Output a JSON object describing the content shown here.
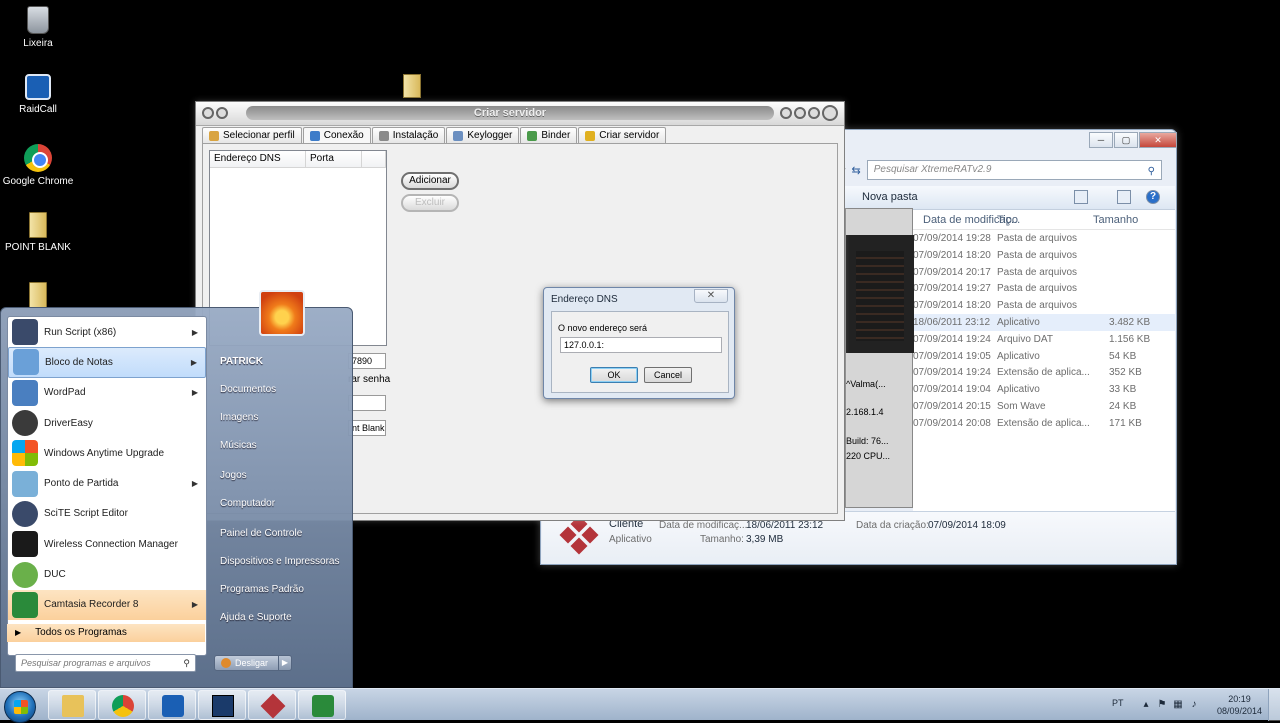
{
  "desktop": {
    "icons": [
      {
        "label": "Lixeira",
        "icon": "recycle-bin-icon"
      },
      {
        "label": "RaidCall",
        "icon": "raidcall-icon"
      },
      {
        "label": "Google Chrome",
        "icon": "chrome-icon"
      },
      {
        "label": "POINT BLANK",
        "icon": "file-icon"
      }
    ]
  },
  "explorer": {
    "search_placeholder": "Pesquisar XtremeRATv2.9",
    "new_folder": "Nova pasta",
    "window_controls": [
      "─",
      "▢",
      "✕"
    ],
    "help": "?",
    "columns": [
      "Data de modificaç...",
      "Tipo",
      "Tamanho"
    ],
    "rows": [
      {
        "date": "07/09/2014 19:28",
        "type": "Pasta de arquivos",
        "size": ""
      },
      {
        "date": "07/09/2014 18:20",
        "type": "Pasta de arquivos",
        "size": ""
      },
      {
        "date": "07/09/2014 20:17",
        "type": "Pasta de arquivos",
        "size": ""
      },
      {
        "date": "07/09/2014 19:27",
        "type": "Pasta de arquivos",
        "size": ""
      },
      {
        "date": "07/09/2014 18:20",
        "type": "Pasta de arquivos",
        "size": ""
      },
      {
        "date": "18/06/2011 23:12",
        "type": "Aplicativo",
        "size": "3.482 KB"
      },
      {
        "date": "07/09/2014 19:24",
        "type": "Arquivo DAT",
        "size": "1.156 KB"
      },
      {
        "date": "07/09/2014 19:05",
        "type": "Aplicativo",
        "size": "54 KB"
      },
      {
        "date": "07/09/2014 19:24",
        "type": "Extensão de aplica...",
        "size": "352 KB"
      },
      {
        "date": "07/09/2014 19:04",
        "type": "Aplicativo",
        "size": "33 KB"
      },
      {
        "date": "07/09/2014 20:15",
        "type": "Som Wave",
        "size": "24 KB"
      },
      {
        "date": "07/09/2014 20:08",
        "type": "Extensão de aplica...",
        "size": "171 KB"
      }
    ],
    "details": {
      "name": "Cliente",
      "kind": "Aplicativo",
      "modified_label": "Data de modificaç...",
      "modified_value": "18/06/2011 23:12",
      "size_label": "Tamanho:",
      "size_value": "3,39 MB",
      "created_label": "Data da criação:",
      "created_value": "07/09/2014 18:09"
    },
    "mini_texts": [
      "^Valma(...",
      "2.168.1.4",
      "Build: 76...",
      "220 CPU..."
    ]
  },
  "server_window": {
    "title": "Criar servidor",
    "tabs": [
      {
        "label": "Selecionar perfil",
        "color": "#d9a441"
      },
      {
        "label": "Conexão",
        "color": "#3d7cc9"
      },
      {
        "label": "Instalação",
        "color": "#8a8a8a"
      },
      {
        "label": "Keylogger",
        "color": "#6b8fc0"
      },
      {
        "label": "Binder",
        "color": "#4a9a4a"
      },
      {
        "label": "Criar servidor",
        "color": "#e0b020"
      }
    ],
    "list_headers": [
      "Endereço DNS",
      "Porta",
      ""
    ],
    "add_button": "Adicionar",
    "remove_button": "Excluir",
    "port_value": "7890",
    "password_label": "rar senha",
    "blank_value": "nt Blank"
  },
  "dialog": {
    "title": "Endereço DNS",
    "close": "✕",
    "label": "O novo endereço será",
    "value": "127.0.0.1:",
    "ok": "OK",
    "cancel": "Cancel"
  },
  "start_menu": {
    "programs": [
      {
        "label": "Run Script (x86)",
        "arrow": "▶",
        "color": "#3a4a6a"
      },
      {
        "label": "Bloco de Notas",
        "arrow": "▶",
        "color": "#6aa0d8"
      },
      {
        "label": "WordPad",
        "arrow": "▶",
        "color": "#4a7fc0"
      },
      {
        "label": "DriverEasy",
        "arrow": "",
        "color": "#3a3a3a"
      },
      {
        "label": "Windows Anytime Upgrade",
        "arrow": "",
        "color": "#3f8fd0"
      },
      {
        "label": "Ponto de Partida",
        "arrow": "▶",
        "color": "#7ab0d8"
      },
      {
        "label": "SciTE Script Editor",
        "arrow": "",
        "color": "#3a4a6a"
      },
      {
        "label": "Wireless Connection Manager",
        "arrow": "",
        "color": "#1a1a1a"
      },
      {
        "label": "DUC",
        "arrow": "",
        "color": "#6ab04a"
      },
      {
        "label": "Camtasia Recorder 8",
        "arrow": "▶",
        "color": "#2a8a3a"
      }
    ],
    "all_programs": "Todos os Programas",
    "search_placeholder": "Pesquisar programas e arquivos",
    "right_items": [
      {
        "label": "PATRICK",
        "bold": true
      },
      {
        "label": "Documentos"
      },
      {
        "label": "Imagens"
      },
      {
        "label": "Músicas"
      },
      {
        "label": "Jogos"
      },
      {
        "label": "Computador"
      },
      {
        "label": "Painel de Controle"
      },
      {
        "label": "Dispositivos e Impressoras"
      },
      {
        "label": "Programas Padrão"
      },
      {
        "label": "Ajuda e Suporte"
      }
    ],
    "shutdown": "Desligar"
  },
  "taskbar": {
    "buttons": [
      {
        "name": "explorer",
        "color": "#e8c25a"
      },
      {
        "name": "chrome",
        "color": "#db4437"
      },
      {
        "name": "raidcall",
        "color": "#1a5fb4"
      },
      {
        "name": "pb",
        "color": "#1a3a6a"
      },
      {
        "name": "xtremerat",
        "color": "#b4343a"
      },
      {
        "name": "camtasia",
        "color": "#2a8a3a"
      }
    ],
    "language": "PT",
    "time": "20:19",
    "date": "08/09/2014"
  }
}
